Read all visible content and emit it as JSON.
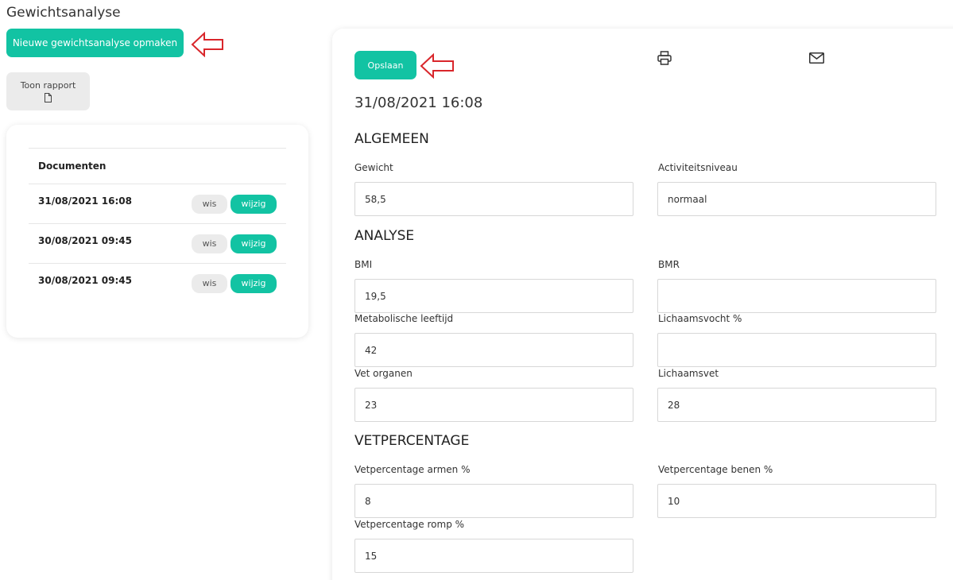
{
  "page": {
    "title": "Gewichtsanalyse"
  },
  "actions": {
    "new_label": "Nieuwe gewichtsanalyse opmaken",
    "report_label": "Toon rapport",
    "save_label": "Opslaan"
  },
  "documents": {
    "header": "Documenten",
    "rows": [
      {
        "date": "31/08/2021 16:08",
        "delete_label": "wis",
        "edit_label": "wijzig"
      },
      {
        "date": "30/08/2021 09:45",
        "delete_label": "wis",
        "edit_label": "wijzig"
      },
      {
        "date": "30/08/2021 09:45",
        "delete_label": "wis",
        "edit_label": "wijzig"
      }
    ]
  },
  "form": {
    "timestamp": "31/08/2021 16:08",
    "sections": {
      "algemeen": "ALGEMEEN",
      "analyse": "ANALYSE",
      "vetpercentage": "VETPERCENTAGE"
    },
    "fields": {
      "gewicht": {
        "label": "Gewicht",
        "value": "58,5"
      },
      "activiteitsniveau": {
        "label": "Activiteitsniveau",
        "value": "normaal"
      },
      "bmi": {
        "label": "BMI",
        "value": "19,5"
      },
      "bmr": {
        "label": "BMR",
        "value": ""
      },
      "metabolische_leeftijd": {
        "label": "Metabolische leeftijd",
        "value": "42"
      },
      "lichaamsvocht": {
        "label": "Lichaamsvocht %",
        "value": ""
      },
      "vet_organen": {
        "label": "Vet organen",
        "value": "23"
      },
      "lichaamsvet": {
        "label": "Lichaamsvet",
        "value": "28"
      },
      "vet_armen": {
        "label": "Vetpercentage armen %",
        "value": "8"
      },
      "vet_benen": {
        "label": "Vetpercentage benen %",
        "value": "10"
      },
      "vet_romp": {
        "label": "Vetpercentage romp %",
        "value": "15"
      }
    }
  },
  "colors": {
    "accent": "#12c3a3",
    "annotation_arrow": "#d9262b",
    "neutral_button": "#ebebeb"
  },
  "icons": {
    "report": "document-icon",
    "print": "printer-icon",
    "mail": "mail-icon",
    "annotation": "arrow-left-icon"
  }
}
